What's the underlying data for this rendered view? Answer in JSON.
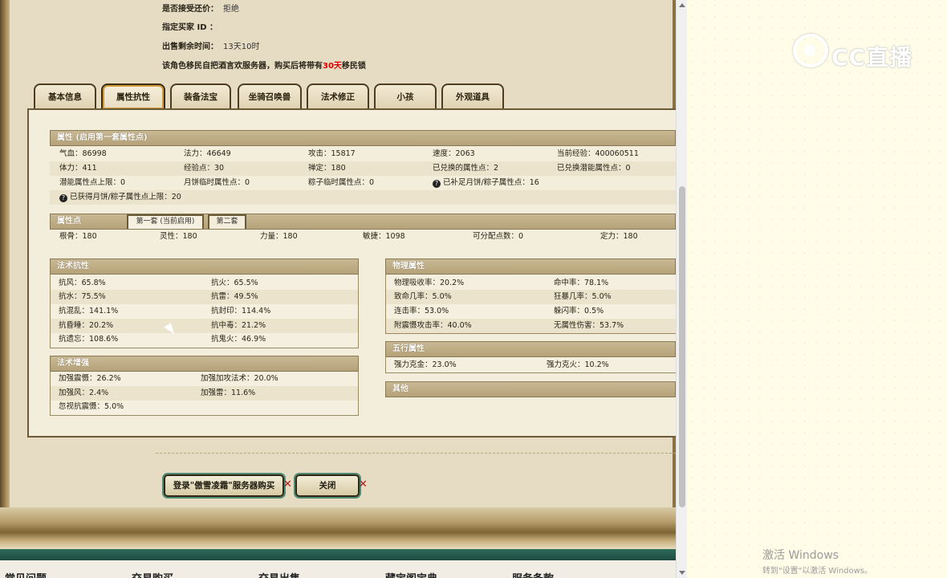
{
  "info": {
    "bargain_label": "是否接受还价：",
    "bargain_value": "拒绝",
    "buyer_label": "指定买家 ID ：",
    "time_label": "出售剩余时间：",
    "time_value": "13天10时",
    "migrate_pre": "该角色移民自把酒言欢服务器，购买后将带有",
    "migrate_days": "30天",
    "migrate_post": "移民锁"
  },
  "tabs": [
    "基本信息",
    "属性抗性",
    "装备法宝",
    "坐骑召唤兽",
    "法术修正",
    "小孩",
    "外观道具"
  ],
  "active_tab": "属性抗性",
  "attributes": {
    "title": "属性 (启用第一套属性点)",
    "rows": [
      [
        "气血：86998",
        "法力：46649",
        "攻击：15817",
        "速度：2063",
        "当前经验：400060511"
      ],
      [
        "体力：411",
        "经验点：30",
        "禅定：180",
        "已兑换的属性点：2",
        "已兑换潜能属性点：0"
      ],
      [
        "潜能属性点上限：0",
        "月饼临时属性点：0",
        "粽子临时属性点：0",
        "已补足月饼/粽子属性点：16",
        ""
      ]
    ],
    "extra": "已获得月饼/粽子属性点上限：20"
  },
  "points": {
    "title": "属性点",
    "subtab1": "第一套 (当前启用)",
    "subtab2": "第二套",
    "row": [
      "根骨：180",
      "灵性：180",
      "力量：180",
      "敏捷：1098",
      "可分配点数：0",
      "定力：180"
    ]
  },
  "magic_resist": {
    "title": "法术抗性",
    "rows": [
      [
        "抗风：65.8%",
        "抗火：65.5%"
      ],
      [
        "抗水：75.5%",
        "抗雷：49.5%"
      ],
      [
        "抗混乱：141.1%",
        "抗封印：114.4%"
      ],
      [
        "抗昏睡：20.2%",
        "抗中毒：21.2%"
      ],
      [
        "抗遗忘：108.6%",
        "抗鬼火：46.9%"
      ]
    ]
  },
  "magic_boost": {
    "title": "法术增强",
    "rows": [
      [
        "加强震慑：26.2%",
        "加强加攻法术：20.0%"
      ],
      [
        "加强风：2.4%",
        "加强雷：11.6%"
      ],
      [
        "忽视抗震慑：5.0%",
        ""
      ]
    ]
  },
  "physical": {
    "title": "物理属性",
    "rows": [
      [
        "物理吸收率：20.2%",
        "命中率：78.1%"
      ],
      [
        "致命几率：5.0%",
        "狂暴几率：5.0%"
      ],
      [
        "连击率：53.0%",
        "躲闪率：0.5%"
      ],
      [
        "附震慑攻击率：40.0%",
        "无属性伤害：53.7%"
      ]
    ]
  },
  "elements": {
    "title": "五行属性",
    "rows": [
      [
        "强力克金：23.0%",
        "强力克火：10.2%"
      ]
    ]
  },
  "other": {
    "title": "其他"
  },
  "buttons": {
    "login": "登录\"傲雪凌霜\"服务器购买",
    "close": "关闭"
  },
  "footer": [
    "常见问题",
    "交易购买",
    "交易出售",
    "藏宝阁宝典",
    "服务条款"
  ],
  "watermark": "CC直播",
  "activate": {
    "line1": "激活 Windows",
    "line2": "转到\"设置\"以激活 Windows。"
  },
  "colors": {
    "highlight_red": "#dd0000",
    "frame_green": "#2d6b5c",
    "bar_tan": "#b5a27a"
  }
}
